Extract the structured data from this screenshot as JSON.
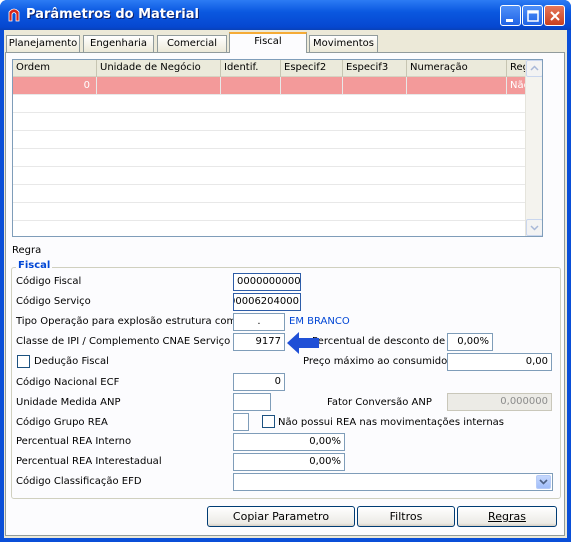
{
  "window": {
    "title": "Parâmetros do Material"
  },
  "tabs": [
    {
      "label": "Planejamento"
    },
    {
      "label": "Engenharia"
    },
    {
      "label": "Comercial"
    },
    {
      "label": "Fiscal"
    },
    {
      "label": "Movimentos"
    }
  ],
  "active_tab": "Fiscal",
  "grid": {
    "columns": [
      "Ordem",
      "Unidade de Negócio",
      "Identif.",
      "Especif2",
      "Especif3",
      "Numeração",
      "Regra"
    ],
    "rows": [
      {
        "ordem": "0",
        "regra": "Não"
      }
    ],
    "selected_row_color": "#f39a9a"
  },
  "regra_label": "Regra",
  "fiscal": {
    "legend": "Fiscal",
    "codigo_fiscal_label": "Código Fiscal",
    "codigo_fiscal_value": "0000000000",
    "codigo_servico_label": "Código Serviço",
    "codigo_servico_value": "00006204000",
    "tipo_operacao_label": "Tipo Operação para explosão estrutura com",
    "tipo_operacao_value": ".",
    "em_branco": "EM BRANCO",
    "classe_ipi_label": "Classe de IPI / Complemento CNAE Serviço",
    "classe_ipi_value": "9177",
    "perc_desconto_st_label": "Percentual de desconto de ST",
    "perc_desconto_st_value": "0,00%",
    "deducao_fiscal_label": "Dedução Fiscal",
    "preco_maximo_label": "Preço máximo ao consumidor",
    "preco_maximo_value": "0,00",
    "codigo_ecf_label": "Código Nacional ECF",
    "codigo_ecf_value": "0",
    "unidade_anp_label": "Unidade Medida ANP",
    "unidade_anp_value": "",
    "fator_anp_label": "Fator Conversão ANP",
    "fator_anp_value": "0,000000",
    "grupo_rea_label": "Código Grupo REA",
    "grupo_rea_value": "",
    "nao_possui_rea_label": "Não possui REA nas movimentações internas",
    "perc_rea_interno_label": "Percentual REA Interno",
    "perc_rea_interno_value": "0,00%",
    "perc_rea_interestadual_label": "Percentual REA Interestadual",
    "perc_rea_interestadual_value": "0,00%",
    "classificacao_efd_label": "Código Classificação EFD",
    "classificacao_efd_value": ""
  },
  "buttons": {
    "copiar": "Copiar Parametro",
    "filtros": "Filtros",
    "regras": "Regras"
  },
  "colors": {
    "accent": "#0046d5",
    "arrow": "#1f4fd6",
    "title_bar": "#0a58e0"
  }
}
